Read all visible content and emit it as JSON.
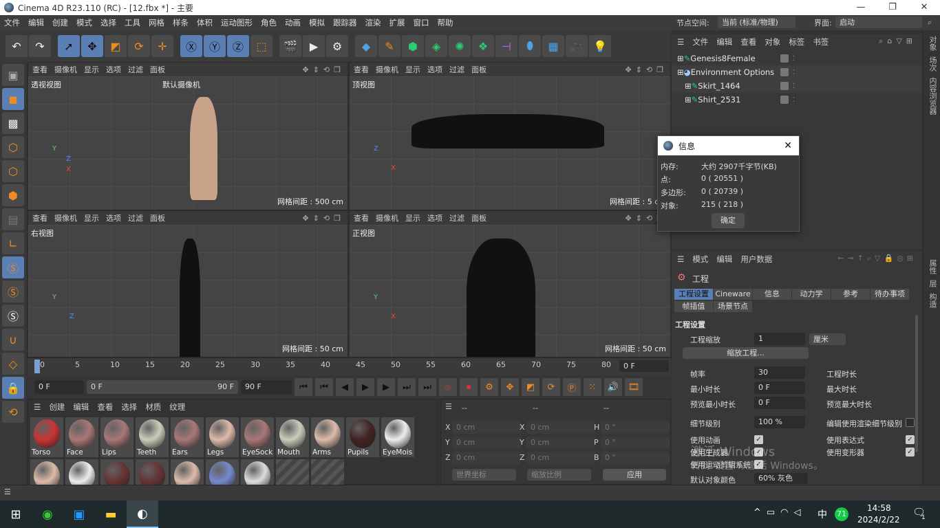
{
  "window": {
    "title": "Cinema 4D R23.110 (RC) - [12.fbx *] - 主要",
    "minimize": "—",
    "maximize": "❐",
    "close": "✕"
  },
  "menu": [
    "文件",
    "编辑",
    "创建",
    "模式",
    "选择",
    "工具",
    "网格",
    "样条",
    "体积",
    "运动图形",
    "角色",
    "动画",
    "模拟",
    "跟踪器",
    "渲染",
    "扩展",
    "窗口",
    "帮助"
  ],
  "node_space": {
    "label": "节点空间:",
    "value": "当前 (标准/物理)"
  },
  "interface": {
    "label": "界面:",
    "value": "启动"
  },
  "viewports": [
    {
      "menu": [
        "查看",
        "摄像机",
        "显示",
        "选项",
        "过滤",
        "面板"
      ],
      "name": "透视视图",
      "camera": "默认摄像机",
      "grid": "网格间距 : 500 cm",
      "axes": [
        "Y",
        "Z",
        "X"
      ]
    },
    {
      "menu": [
        "查看",
        "摄像机",
        "显示",
        "选项",
        "过滤",
        "面板"
      ],
      "name": "顶视图",
      "grid": "网格间距 : 5 cm",
      "axes": [
        "Z",
        "X"
      ]
    },
    {
      "menu": [
        "查看",
        "摄像机",
        "显示",
        "选项",
        "过滤",
        "面板"
      ],
      "name": "右视图",
      "grid": "网格间距 : 50 cm",
      "axes": [
        "Y",
        "Z"
      ]
    },
    {
      "menu": [
        "查看",
        "摄像机",
        "显示",
        "选项",
        "过滤",
        "面板"
      ],
      "name": "正视图",
      "grid": "网格间距 : 50 cm",
      "axes": [
        "Y",
        "X"
      ]
    }
  ],
  "timeline": {
    "ticks": [
      "0",
      "5",
      "10",
      "15",
      "20",
      "25",
      "30",
      "35",
      "40",
      "45",
      "50",
      "55",
      "60",
      "65",
      "70",
      "75",
      "80",
      "85",
      "90"
    ],
    "current_frame": 0,
    "current": "0 F",
    "range_start": "0 F",
    "range_end": "90 F",
    "end": "90 F",
    "right_field": "0 F"
  },
  "materials": {
    "menu": [
      "创建",
      "编辑",
      "查看",
      "选择",
      "材质",
      "纹理"
    ],
    "items": [
      {
        "name": "Torso",
        "color": "#c33"
      },
      {
        "name": "Face",
        "color": "#a77"
      },
      {
        "name": "Lips",
        "color": "#a77"
      },
      {
        "name": "Teeth",
        "color": "#ccb"
      },
      {
        "name": "Ears",
        "color": "#a77"
      },
      {
        "name": "Legs",
        "color": "#dba"
      },
      {
        "name": "EyeSock",
        "color": "#a77"
      },
      {
        "name": "Mouth",
        "color": "#ccb"
      },
      {
        "name": "Arms",
        "color": "#dba"
      },
      {
        "name": "Pupils",
        "color": "#422"
      },
      {
        "name": "EyeMois",
        "color": "#eee"
      },
      {
        "name": "",
        "color": "#dba"
      },
      {
        "name": "",
        "color": "#eee"
      },
      {
        "name": "",
        "color": "#633"
      },
      {
        "name": "",
        "color": "#633"
      },
      {
        "name": "",
        "color": "#dba"
      },
      {
        "name": "",
        "color": "#78c"
      },
      {
        "name": "",
        "color": "#ddd"
      }
    ]
  },
  "coords": {
    "headers": [
      "--",
      "--",
      "--"
    ],
    "rows": [
      [
        "X",
        "0 cm",
        "X",
        "0 cm",
        "H",
        "0 °"
      ],
      [
        "Y",
        "0 cm",
        "Y",
        "0 cm",
        "P",
        "0 °"
      ],
      [
        "Z",
        "0 cm",
        "Z",
        "0 cm",
        "B",
        "0 °"
      ]
    ],
    "mode": "世界坐标",
    "scale": "缩放比例",
    "apply": "应用"
  },
  "objects": {
    "menu": [
      "文件",
      "编辑",
      "查看",
      "对象",
      "标签",
      "书签"
    ],
    "items": [
      {
        "name": "Genesis8Female",
        "indent": 0
      },
      {
        "name": "Environment Options",
        "indent": 0
      },
      {
        "name": "Skirt_1464",
        "indent": 1
      },
      {
        "name": "Shirt_2531",
        "indent": 1
      }
    ]
  },
  "info_dialog": {
    "title": "信息",
    "rows": [
      [
        "内存:",
        "大约 2907千字节(KB)"
      ],
      [
        "点:",
        "0 ( 20551 )"
      ],
      [
        "多边形:",
        "0 ( 20739 )"
      ],
      [
        "对象:",
        "215 ( 218 )"
      ]
    ],
    "ok": "确定"
  },
  "attributes": {
    "menu": [
      "模式",
      "编辑",
      "用户数据"
    ],
    "object": "工程",
    "tabs": [
      "工程设置",
      "Cineware",
      "信息",
      "动力学",
      "参考",
      "待办事项",
      "帧插值",
      "场景节点"
    ],
    "section": "工程设置",
    "scale_label": "工程缩放",
    "scale_value": "1",
    "scale_unit": "厘米",
    "scale_button": "缩放工程...",
    "fps_label": "帧率",
    "fps": "30",
    "min_label": "最小时长",
    "min": "0 F",
    "pmin_label": "预览最小时长",
    "pmin": "0 F",
    "duration_label": "工程时长",
    "max_label": "最大时长",
    "pmax_label": "预览最大时长",
    "lod_label": "细节级别",
    "lod": "100 %",
    "render_lod_label": "编辑使用渲染细节级别",
    "checks": [
      {
        "label": "使用动画",
        "checked": true
      },
      {
        "label": "使用表达式",
        "checked": true
      },
      {
        "label": "使用生成器",
        "checked": true
      },
      {
        "label": "使用变形器",
        "checked": true
      },
      {
        "label": "使用运动剪辑系统",
        "checked": true
      }
    ],
    "default_color_label": "默认对象颜色",
    "default_color": "60% 灰色"
  },
  "side_tabs": [
    "对象",
    "场次",
    "内容浏览器",
    "属性",
    "层",
    "构造"
  ],
  "activation": {
    "line1": "激活 Windows",
    "line2": "转到\"设置\"以激活 Windows。"
  },
  "taskbar": {
    "time": "14:58",
    "date": "2024/2/22",
    "ime": "中",
    "badge": "71",
    "notifications": "1"
  }
}
